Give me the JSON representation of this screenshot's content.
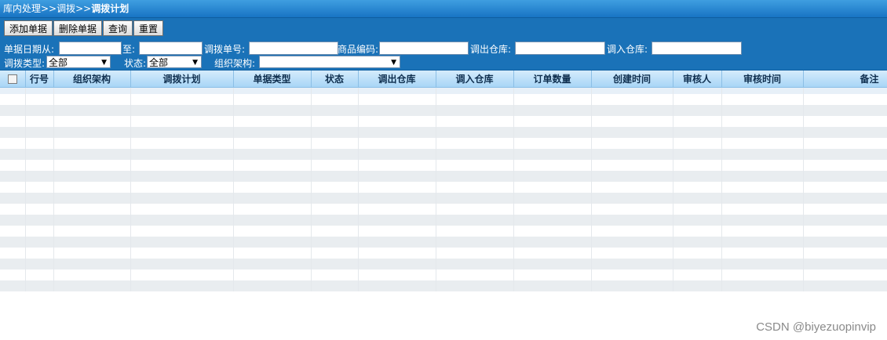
{
  "breadcrumb": {
    "path": "库内处理>>调拨>>",
    "current": "调拨计划"
  },
  "toolbar": {
    "add": "添加单据",
    "delete": "删除单据",
    "query": "查询",
    "reset": "重置"
  },
  "filters": {
    "date_from_label": "单据日期从:",
    "date_to_label": "至:",
    "transfer_no_label": "调拨单号:",
    "product_code_label": "商品编码:",
    "out_warehouse_label": "调出仓库:",
    "in_warehouse_label": "调入仓库:",
    "transfer_type_label": "调拨类型:",
    "transfer_type_value": "全部",
    "status_label": "状态:",
    "status_value": "全部",
    "org_label": "组织架构:",
    "org_value": ""
  },
  "table": {
    "columns": [
      "行号",
      "组织架构",
      "调拨计划",
      "单据类型",
      "状态",
      "调出仓库",
      "调入仓库",
      "订单数量",
      "创建时间",
      "审核人",
      "审核时间",
      "备注"
    ]
  },
  "watermark": "CSDN @biyezuopinvip"
}
